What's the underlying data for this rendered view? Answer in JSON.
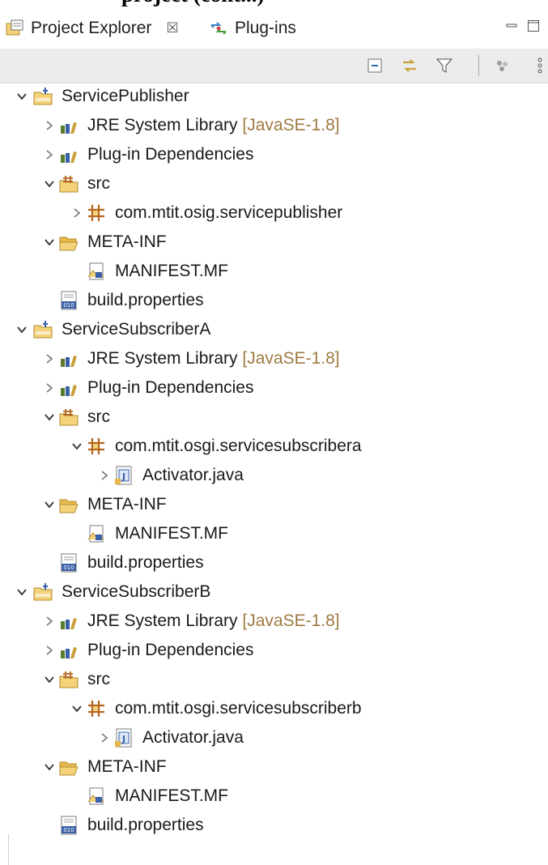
{
  "caption": "project (cont...)",
  "tabs": [
    {
      "label": "Project Explorer",
      "close": "☒",
      "active": true
    },
    {
      "label": "Plug-ins",
      "active": false
    }
  ],
  "toolbar": {
    "collapse_all": "collapse-all-icon",
    "link_editor": "link-with-editor-icon",
    "filter": "filter-icon",
    "focus": "focus-icon",
    "view_menu": "view-menu-icon"
  },
  "tree": {
    "project1": {
      "name": "ServicePublisher",
      "jre": "JRE System Library",
      "jre_deco": "[JavaSE-1.8]",
      "deps": "Plug-in Dependencies",
      "src": "src",
      "pkg": "com.mtit.osig.servicepublisher",
      "metainf": "META-INF",
      "manifest": "MANIFEST.MF",
      "build": "build.properties"
    },
    "project2": {
      "name": "ServiceSubscriberA",
      "jre": "JRE System Library",
      "jre_deco": "[JavaSE-1.8]",
      "deps": "Plug-in Dependencies",
      "src": "src",
      "pkg": "com.mtit.osgi.servicesubscribera",
      "activator": "Activator.java",
      "metainf": "META-INF",
      "manifest": "MANIFEST.MF",
      "build": "build.properties"
    },
    "project3": {
      "name": "ServiceSubscriberB",
      "jre": "JRE System Library",
      "jre_deco": "[JavaSE-1.8]",
      "deps": "Plug-in Dependencies",
      "src": "src",
      "pkg": "com.mtit.osgi.servicesubscriberb",
      "activator": "Activator.java",
      "metainf": "META-INF",
      "manifest": "MANIFEST.MF",
      "build": "build.properties"
    }
  },
  "colors": {
    "folder": "#e8b84a",
    "library": "#5a7b2a",
    "decoration": "#9d7b41",
    "java_badge": "#3a61a8"
  }
}
